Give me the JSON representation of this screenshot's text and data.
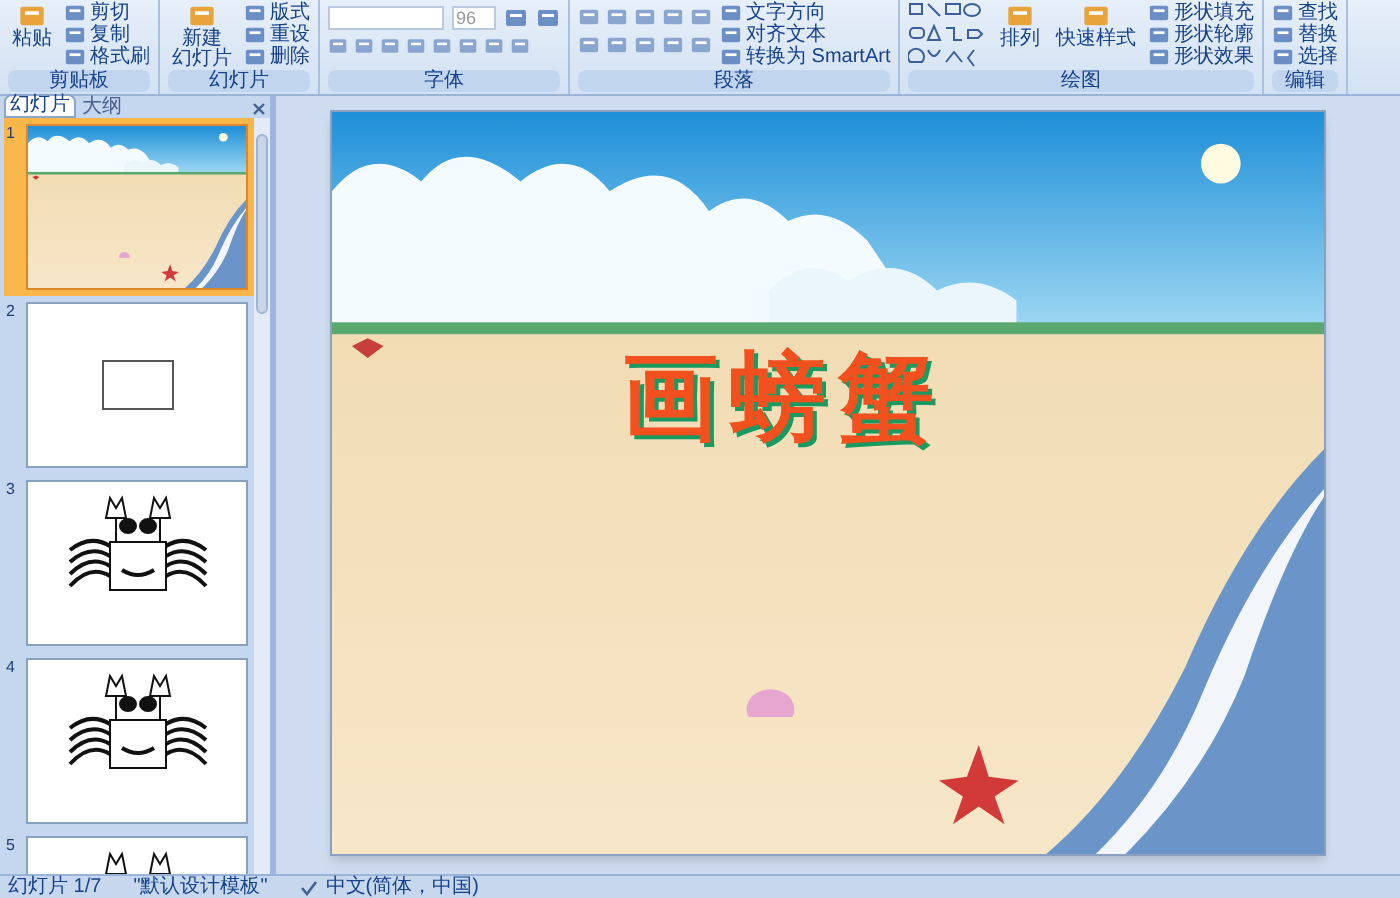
{
  "ribbon": {
    "groups": [
      {
        "label": "剪贴板",
        "items": [
          {
            "label": "粘贴",
            "kind": "big"
          },
          {
            "label": "剪切",
            "kind": "small"
          },
          {
            "label": "复制",
            "kind": "small"
          },
          {
            "label": "格式刷",
            "kind": "small"
          }
        ]
      },
      {
        "label": "幻灯片",
        "items": [
          {
            "lines": [
              "新建",
              "幻灯片"
            ],
            "kind": "big"
          },
          {
            "label": "版式",
            "kind": "small"
          },
          {
            "label": "重设",
            "kind": "small"
          },
          {
            "label": "删除",
            "kind": "small"
          }
        ]
      },
      {
        "label": "字体",
        "kind": "font",
        "font_size": "96"
      },
      {
        "label": "段落",
        "kind": "paragraph",
        "items": [
          {
            "label": "文字方向",
            "kind": "small"
          },
          {
            "label": "对齐文本",
            "kind": "small"
          },
          {
            "label": "转换为 SmartArt",
            "kind": "small"
          }
        ]
      },
      {
        "label": "绘图",
        "kind": "drawing",
        "items": [
          {
            "label": "排列",
            "kind": "big"
          },
          {
            "label": "快速样式",
            "kind": "big"
          },
          {
            "label": "形状填充",
            "kind": "small"
          },
          {
            "label": "形状轮廓",
            "kind": "small"
          },
          {
            "label": "形状效果",
            "kind": "small"
          }
        ]
      },
      {
        "label": "编辑",
        "items": [
          {
            "label": "查找",
            "kind": "small"
          },
          {
            "label": "替换",
            "kind": "small"
          },
          {
            "label": "选择",
            "kind": "small"
          }
        ]
      }
    ]
  },
  "panel": {
    "tabs": [
      {
        "label": "幻灯片",
        "selected": true
      },
      {
        "label": "大纲",
        "selected": false
      }
    ],
    "slides": [
      {
        "number": "1",
        "kind": "beach",
        "selected": true
      },
      {
        "number": "2",
        "kind": "rectangle",
        "selected": false
      },
      {
        "number": "3",
        "kind": "crab",
        "selected": false
      },
      {
        "number": "4",
        "kind": "crab",
        "selected": false
      },
      {
        "number": "5",
        "kind": "crab",
        "selected": false
      }
    ]
  },
  "slide": {
    "title": "画螃蟹"
  },
  "status_bar": {
    "slide_count": "幻灯片 1/7",
    "template": "\"默认设计模板\"",
    "language": "中文(简体，中国)"
  }
}
